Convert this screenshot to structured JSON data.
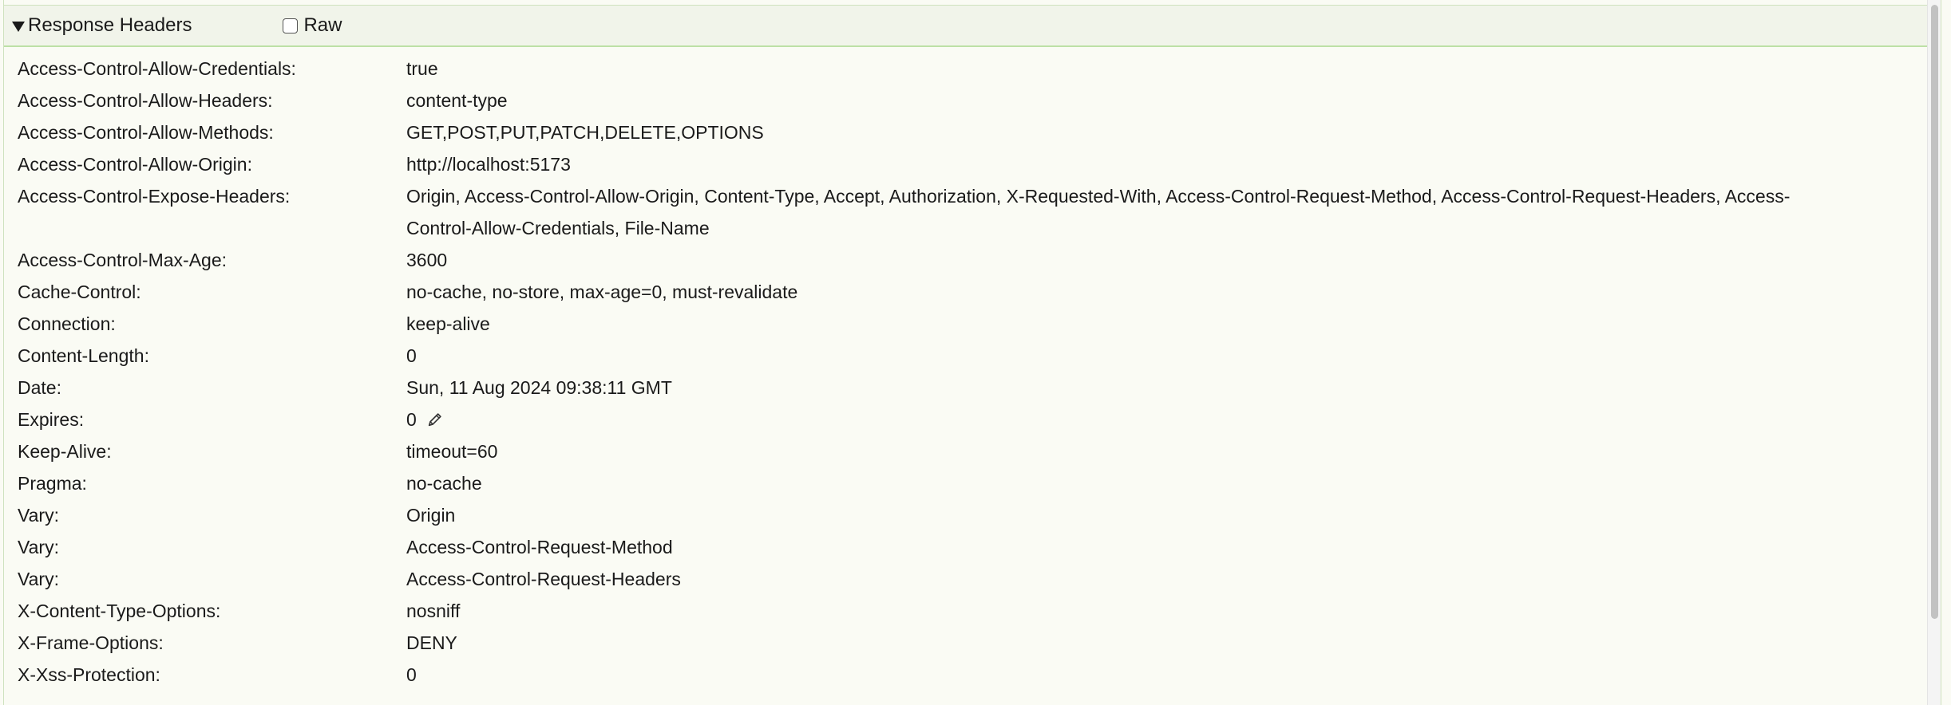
{
  "section": {
    "title": "Response Headers",
    "raw_label": "Raw",
    "raw_checked": false
  },
  "headers": [
    {
      "name": "Access-Control-Allow-Credentials:",
      "value": "true"
    },
    {
      "name": "Access-Control-Allow-Headers:",
      "value": "content-type"
    },
    {
      "name": "Access-Control-Allow-Methods:",
      "value": "GET,POST,PUT,PATCH,DELETE,OPTIONS"
    },
    {
      "name": "Access-Control-Allow-Origin:",
      "value": "http://localhost:5173"
    },
    {
      "name": "Access-Control-Expose-Headers:",
      "value": "Origin, Access-Control-Allow-Origin, Content-Type, Accept, Authorization, X-Requested-With, Access-Control-Request-Method, Access-Control-Request-Headers, Access-Control-Allow-Credentials, File-Name"
    },
    {
      "name": "Access-Control-Max-Age:",
      "value": "3600"
    },
    {
      "name": "Cache-Control:",
      "value": "no-cache, no-store, max-age=0, must-revalidate"
    },
    {
      "name": "Connection:",
      "value": "keep-alive"
    },
    {
      "name": "Content-Length:",
      "value": "0"
    },
    {
      "name": "Date:",
      "value": "Sun, 11 Aug 2024 09:38:11 GMT"
    },
    {
      "name": "Expires:",
      "value": "0",
      "icon": "pencil-icon"
    },
    {
      "name": "Keep-Alive:",
      "value": "timeout=60"
    },
    {
      "name": "Pragma:",
      "value": "no-cache"
    },
    {
      "name": "Vary:",
      "value": "Origin"
    },
    {
      "name": "Vary:",
      "value": "Access-Control-Request-Method"
    },
    {
      "name": "Vary:",
      "value": "Access-Control-Request-Headers"
    },
    {
      "name": "X-Content-Type-Options:",
      "value": "nosniff"
    },
    {
      "name": "X-Frame-Options:",
      "value": "DENY"
    },
    {
      "name": "X-Xss-Protection:",
      "value": "0"
    }
  ],
  "colors": {
    "panel_background": "#fafbf4",
    "header_background": "#f1f4ea",
    "header_border": "#bde0a6",
    "text": "#1a1a1a"
  }
}
